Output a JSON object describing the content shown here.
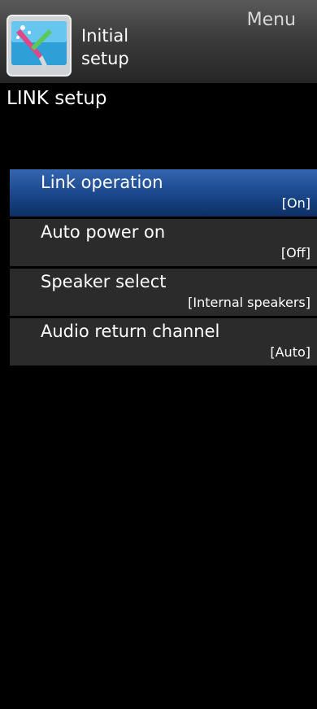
{
  "header": {
    "label_line1": "Initial",
    "label_line2": "setup",
    "menu_label": "Menu",
    "icon": "initial-setup-icon"
  },
  "page": {
    "title": "LINK setup"
  },
  "menu": {
    "items": [
      {
        "label": "Link operation",
        "value": "[On]",
        "selected": true
      },
      {
        "label": "Auto power on",
        "value": "[Off]",
        "selected": false
      },
      {
        "label": "Speaker select",
        "value": "[Internal speakers]",
        "selected": false
      },
      {
        "label": "Audio return channel",
        "value": "[Auto]",
        "selected": false
      }
    ]
  },
  "colors": {
    "selected_bg": "#1a4689",
    "item_bg": "#2b2b2b",
    "screen_bg": "#000000"
  }
}
